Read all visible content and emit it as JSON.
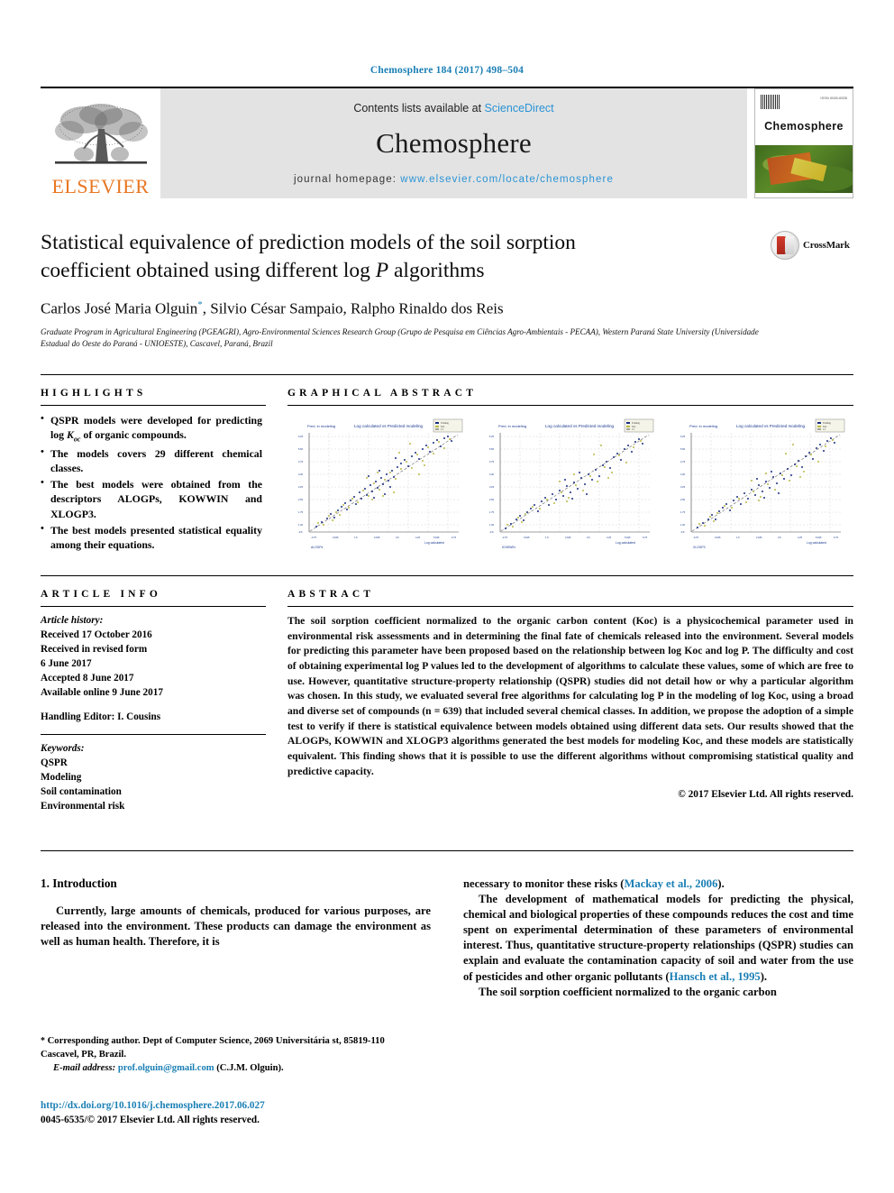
{
  "running_head": "Chemosphere 184 (2017) 498–504",
  "masthead": {
    "publisher_logo_text": "ELSEVIER",
    "contents_prefix": "Contents lists available at ",
    "contents_link": "ScienceDirect",
    "journal_name": "Chemosphere",
    "homepage_prefix": "journal homepage: ",
    "homepage_url": "www.elsevier.com/locate/chemosphere",
    "cover_title": "Chemosphere",
    "cover_issn": "ISSN 0045-6535"
  },
  "article": {
    "title_line1": "Statistical equivalence of prediction models of the soil sorption",
    "title_line2_a": "coefficient obtained using different log ",
    "title_line2_italic": "P",
    "title_line2_b": " algorithms",
    "authors": "Carlos José Maria Olguin",
    "author_star": "*",
    "authors_rest": ", Silvio César Sampaio, Ralpho Rinaldo dos Reis",
    "affiliation": "Graduate Program in Agricultural Engineering (PGEAGRI), Agro-Environmental Sciences Research Group (Grupo de Pesquisa em Ciências Agro-Ambientais - PECAA), Western Paraná State University (Universidade Estadual do Oeste do Paraná - UNIOESTE), Cascavel, Paraná, Brazil",
    "crossmark_label": "CrossMark"
  },
  "highlights": {
    "heading": "HIGHLIGHTS",
    "items": [
      "QSPR models were developed for predicting log K₀꜀ of organic compounds.",
      "The models covers 29 different chemical classes.",
      "The best models were obtained from the descriptors ALOGPs, KOWWIN and XLOGP3.",
      "The best models presented statistical equality among their equations."
    ]
  },
  "graphical_abstract": {
    "heading": "GRAPHICAL ABSTRACT"
  },
  "article_info": {
    "heading": "ARTICLE INFO",
    "history_label": "Article history:",
    "received": "Received 17 October 2016",
    "revised_label": "Received in revised form",
    "revised_date": "6 June 2017",
    "accepted": "Accepted 8 June 2017",
    "available": "Available online 9 June 2017",
    "handling_editor": "Handling Editor: I. Cousins",
    "keywords_label": "Keywords:",
    "keywords": [
      "QSPR",
      "Modeling",
      "Soil contamination",
      "Environmental risk"
    ]
  },
  "abstract": {
    "heading": "ABSTRACT",
    "text": "The soil sorption coefficient normalized to the organic carbon content (Koc) is a physicochemical parameter used in environmental risk assessments and in determining the final fate of chemicals released into the environment. Several models for predicting this parameter have been proposed based on the relationship between log Koc and log P. The difficulty and cost of obtaining experimental log P values led to the development of algorithms to calculate these values, some of which are free to use. However, quantitative structure-property relationship (QSPR) studies did not detail how or why a particular algorithm was chosen. In this study, we evaluated several free algorithms for calculating log P in the modeling of log Koc, using a broad and diverse set of compounds (n = 639) that included several chemical classes. In addition, we propose the adoption of a simple test to verify if there is statistical equivalence between models obtained using different data sets. Our results showed that the ALOGPs, KOWWIN and XLOGP3 algorithms generated the best models for modeling Koc, and these models are statistically equivalent. This finding shows that it is possible to use the different algorithms without compromising statistical quality and predictive capacity.",
    "copyright": "© 2017 Elsevier Ltd. All rights reserved."
  },
  "body": {
    "section_number_title": "1. Introduction",
    "left_paragraph": "Currently, large amounts of chemicals, produced for various purposes, are released into the environment. These products can damage the environment as well as human health. Therefore, it is",
    "right_p1_text": "necessary to monitor these risks (",
    "right_p1_cite": "Mackay et al., 2006",
    "right_p1_tail": ").",
    "right_p2_text": "The development of mathematical models for predicting the physical, chemical and biological properties of these compounds reduces the cost and time spent on experimental determination of these parameters of environmental interest. Thus, quantitative structure-property relationships (QSPR) studies can explain and evaluate the contamination capacity of soil and water from the use of pesticides and other organic pollutants (",
    "right_p2_cite": "Hansch et al., 1995",
    "right_p2_tail": ").",
    "right_p3": "The soil sorption coefficient normalized to the organic carbon"
  },
  "footnote": {
    "star": "*",
    "corresponding": " Corresponding author. Dept of Computer Science, 2069 Universitária st, 85819-110 Cascavel, PR, Brazil.",
    "email_label": "E-mail address:",
    "email": "prof.olguin@gmail.com",
    "email_owner": " (C.J.M. Olguin)."
  },
  "footer": {
    "doi": "http://dx.doi.org/10.1016/j.chemosphere.2017.06.027",
    "issn_line": "0045-6535/© 2017 Elsevier Ltd. All rights reserved."
  },
  "colors": {
    "link": "#1a7fb5",
    "sciencedirect": "#2a93d5",
    "elsevier_orange": "#E87722",
    "band_gray": "#e3e3e3"
  },
  "chart_data": [
    {
      "type": "scatter",
      "title": "Log calculated vs Predicted modeling",
      "xlabel": "ALOGPs",
      "ylabel": "Pred. ln modeling",
      "legend": [
        "Training",
        "Test",
        "1:1 line"
      ],
      "xlim": [
        -0.75,
        6.75
      ],
      "ylim": [
        -0.5,
        6.5
      ],
      "xticks": [
        "-0.75",
        "0.625",
        "1.5",
        "2.625",
        "3.5",
        "4.25",
        "5.625",
        "6.75"
      ],
      "yticks": [
        "6.25",
        "5.50",
        "4.75",
        "4.00",
        "3.25",
        "2.50",
        "1.75",
        "1.00",
        "0.25",
        "-0.5"
      ],
      "n_points": 639,
      "grid": true
    },
    {
      "type": "scatter",
      "title": "Log calculated vs Predicted modeling",
      "xlabel": "KOWWIN",
      "ylabel": "Pred. ln modeling",
      "legend": [
        "Training",
        "Test",
        "1:1 line"
      ],
      "xlim": [
        -0.75,
        6.75
      ],
      "ylim": [
        -0.5,
        6.5
      ],
      "n_points": 639,
      "grid": true
    },
    {
      "type": "scatter",
      "title": "Log calculated vs Predicted modeling",
      "xlabel": "XLOGP3",
      "ylabel": "Pred. ln modeling",
      "legend": [
        "Training",
        "Test",
        "1:1 line"
      ],
      "xlim": [
        -0.75,
        6.75
      ],
      "ylim": [
        -0.5,
        6.5
      ],
      "n_points": 639,
      "grid": true
    }
  ]
}
